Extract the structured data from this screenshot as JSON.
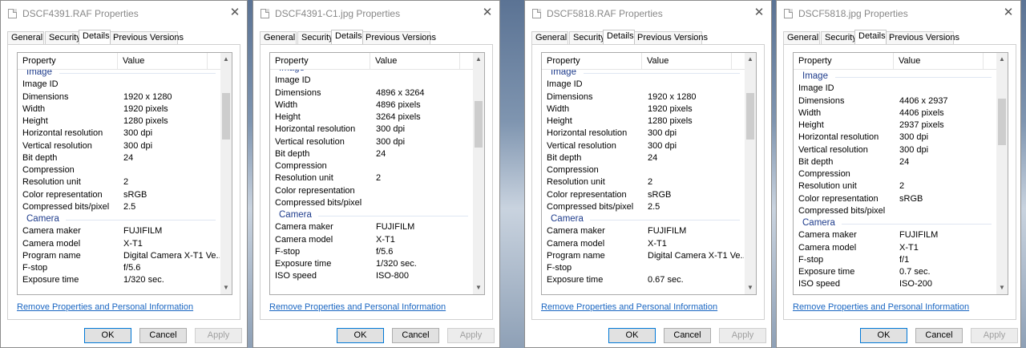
{
  "tab_labels": [
    "General",
    "Security",
    "Details",
    "Previous Versions"
  ],
  "column_headers": {
    "property": "Property",
    "value": "Value"
  },
  "remove_link": "Remove Properties and Personal Information",
  "buttons": {
    "ok": "OK",
    "cancel": "Cancel",
    "apply": "Apply"
  },
  "close_glyph": "✕",
  "icons": {
    "file": "file-icon",
    "close": "close-icon",
    "scroll_up": "chevron-up-icon",
    "scroll_down": "chevron-down-icon"
  },
  "colors": {
    "link": "#1a66c2",
    "group_header": "#1e3c8c"
  },
  "dialogs": [
    {
      "title": "DSCF4391.RAF Properties",
      "scroll_fraction": 0.2,
      "rows": [
        {
          "type": "group",
          "label": "Image"
        },
        {
          "type": "row",
          "p": "Image ID",
          "v": ""
        },
        {
          "type": "row",
          "p": "Dimensions",
          "v": "1920 x 1280"
        },
        {
          "type": "row",
          "p": "Width",
          "v": "1920 pixels"
        },
        {
          "type": "row",
          "p": "Height",
          "v": "1280 pixels"
        },
        {
          "type": "row",
          "p": "Horizontal resolution",
          "v": "300 dpi"
        },
        {
          "type": "row",
          "p": "Vertical resolution",
          "v": "300 dpi"
        },
        {
          "type": "row",
          "p": "Bit depth",
          "v": "24"
        },
        {
          "type": "row",
          "p": "Compression",
          "v": ""
        },
        {
          "type": "row",
          "p": "Resolution unit",
          "v": "2"
        },
        {
          "type": "row",
          "p": "Color representation",
          "v": "sRGB"
        },
        {
          "type": "row",
          "p": "Compressed bits/pixel",
          "v": "2.5"
        },
        {
          "type": "group",
          "label": "Camera"
        },
        {
          "type": "row",
          "p": "Camera maker",
          "v": "FUJIFILM"
        },
        {
          "type": "row",
          "p": "Camera model",
          "v": "X-T1"
        },
        {
          "type": "row",
          "p": "Program name",
          "v": "Digital Camera X-T1 Ve..."
        },
        {
          "type": "row",
          "p": "F-stop",
          "v": "f/5.6"
        },
        {
          "type": "row",
          "p": "Exposure time",
          "v": "1/320 sec."
        }
      ]
    },
    {
      "title": "DSCF4391-C1.jpg Properties",
      "scroll_fraction": 0.22,
      "rows": [
        {
          "type": "group",
          "label": "Image"
        },
        {
          "type": "row",
          "p": "Image ID",
          "v": ""
        },
        {
          "type": "row",
          "p": "Dimensions",
          "v": "4896 x 3264"
        },
        {
          "type": "row",
          "p": "Width",
          "v": "4896 pixels"
        },
        {
          "type": "row",
          "p": "Height",
          "v": "3264 pixels"
        },
        {
          "type": "row",
          "p": "Horizontal resolution",
          "v": "300 dpi"
        },
        {
          "type": "row",
          "p": "Vertical resolution",
          "v": "300 dpi"
        },
        {
          "type": "row",
          "p": "Bit depth",
          "v": "24"
        },
        {
          "type": "row",
          "p": "Compression",
          "v": ""
        },
        {
          "type": "row",
          "p": "Resolution unit",
          "v": "2"
        },
        {
          "type": "row",
          "p": "Color representation",
          "v": ""
        },
        {
          "type": "row",
          "p": "Compressed bits/pixel",
          "v": ""
        },
        {
          "type": "group",
          "label": "Camera"
        },
        {
          "type": "row",
          "p": "Camera maker",
          "v": "FUJIFILM"
        },
        {
          "type": "row",
          "p": "Camera model",
          "v": "X-T1"
        },
        {
          "type": "row",
          "p": "F-stop",
          "v": "f/5.6"
        },
        {
          "type": "row",
          "p": "Exposure time",
          "v": "1/320 sec."
        },
        {
          "type": "row",
          "p": "ISO speed",
          "v": "ISO-800"
        }
      ]
    },
    {
      "title": "DSCF5818.RAF Properties",
      "scroll_fraction": 0.2,
      "rows": [
        {
          "type": "group",
          "label": "Image"
        },
        {
          "type": "row",
          "p": "Image ID",
          "v": ""
        },
        {
          "type": "row",
          "p": "Dimensions",
          "v": "1920 x 1280"
        },
        {
          "type": "row",
          "p": "Width",
          "v": "1920 pixels"
        },
        {
          "type": "row",
          "p": "Height",
          "v": "1280 pixels"
        },
        {
          "type": "row",
          "p": "Horizontal resolution",
          "v": "300 dpi"
        },
        {
          "type": "row",
          "p": "Vertical resolution",
          "v": "300 dpi"
        },
        {
          "type": "row",
          "p": "Bit depth",
          "v": "24"
        },
        {
          "type": "row",
          "p": "Compression",
          "v": ""
        },
        {
          "type": "row",
          "p": "Resolution unit",
          "v": "2"
        },
        {
          "type": "row",
          "p": "Color representation",
          "v": "sRGB"
        },
        {
          "type": "row",
          "p": "Compressed bits/pixel",
          "v": "2.5"
        },
        {
          "type": "group",
          "label": "Camera"
        },
        {
          "type": "row",
          "p": "Camera maker",
          "v": "FUJIFILM"
        },
        {
          "type": "row",
          "p": "Camera model",
          "v": "X-T1"
        },
        {
          "type": "row",
          "p": "Program name",
          "v": "Digital Camera X-T1 Ve..."
        },
        {
          "type": "row",
          "p": "F-stop",
          "v": ""
        },
        {
          "type": "row",
          "p": "Exposure time",
          "v": "0.67 sec."
        }
      ]
    },
    {
      "title": "DSCF5818.jpg Properties",
      "scroll_fraction": 0.18,
      "rows": [
        {
          "type": "group",
          "label": "Image"
        },
        {
          "type": "row",
          "p": "Image ID",
          "v": ""
        },
        {
          "type": "row",
          "p": "Dimensions",
          "v": "4406 x 2937"
        },
        {
          "type": "row",
          "p": "Width",
          "v": "4406 pixels"
        },
        {
          "type": "row",
          "p": "Height",
          "v": "2937 pixels"
        },
        {
          "type": "row",
          "p": "Horizontal resolution",
          "v": "300 dpi"
        },
        {
          "type": "row",
          "p": "Vertical resolution",
          "v": "300 dpi"
        },
        {
          "type": "row",
          "p": "Bit depth",
          "v": "24"
        },
        {
          "type": "row",
          "p": "Compression",
          "v": ""
        },
        {
          "type": "row",
          "p": "Resolution unit",
          "v": "2"
        },
        {
          "type": "row",
          "p": "Color representation",
          "v": "sRGB"
        },
        {
          "type": "row",
          "p": "Compressed bits/pixel",
          "v": ""
        },
        {
          "type": "group",
          "label": "Camera"
        },
        {
          "type": "row",
          "p": "Camera maker",
          "v": "FUJIFILM"
        },
        {
          "type": "row",
          "p": "Camera model",
          "v": "X-T1"
        },
        {
          "type": "row",
          "p": "F-stop",
          "v": "f/1"
        },
        {
          "type": "row",
          "p": "Exposure time",
          "v": "0.7 sec."
        },
        {
          "type": "row",
          "p": "ISO speed",
          "v": "ISO-200"
        }
      ]
    }
  ]
}
